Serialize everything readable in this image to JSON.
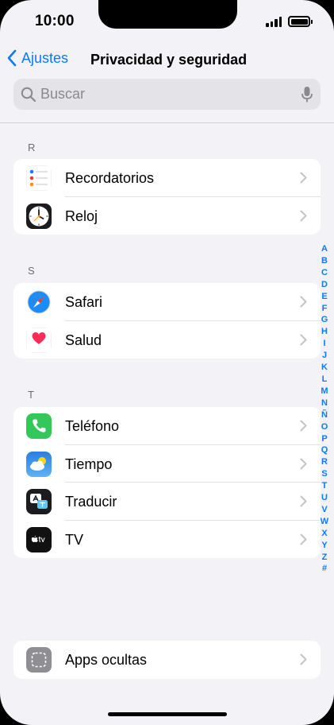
{
  "status": {
    "time": "10:00"
  },
  "nav": {
    "back_label": "Ajustes",
    "title": "Privacidad y seguridad"
  },
  "search": {
    "placeholder": "Buscar"
  },
  "sections": [
    {
      "letter": "R",
      "items": [
        {
          "label": "Recordatorios",
          "icon": "reminders-icon"
        },
        {
          "label": "Reloj",
          "icon": "clock-icon"
        }
      ]
    },
    {
      "letter": "S",
      "items": [
        {
          "label": "Safari",
          "icon": "safari-icon"
        },
        {
          "label": "Salud",
          "icon": "health-icon"
        }
      ]
    },
    {
      "letter": "T",
      "items": [
        {
          "label": "Teléfono",
          "icon": "phone-icon"
        },
        {
          "label": "Tiempo",
          "icon": "weather-icon"
        },
        {
          "label": "Traducir",
          "icon": "translate-icon"
        },
        {
          "label": "TV",
          "icon": "tv-icon"
        }
      ]
    }
  ],
  "hidden_apps": {
    "label": "Apps ocultas",
    "icon": "hidden-apps-icon"
  },
  "index_letters": [
    "A",
    "B",
    "C",
    "D",
    "E",
    "F",
    "G",
    "H",
    "I",
    "J",
    "K",
    "L",
    "M",
    "N",
    "Ñ",
    "O",
    "P",
    "Q",
    "R",
    "S",
    "T",
    "U",
    "V",
    "W",
    "X",
    "Y",
    "Z",
    "#"
  ],
  "colors": {
    "accent": "#0a7aff",
    "background": "#f2f2f7",
    "phone_green": "#34c759",
    "heart_red": "#ff2d55"
  }
}
